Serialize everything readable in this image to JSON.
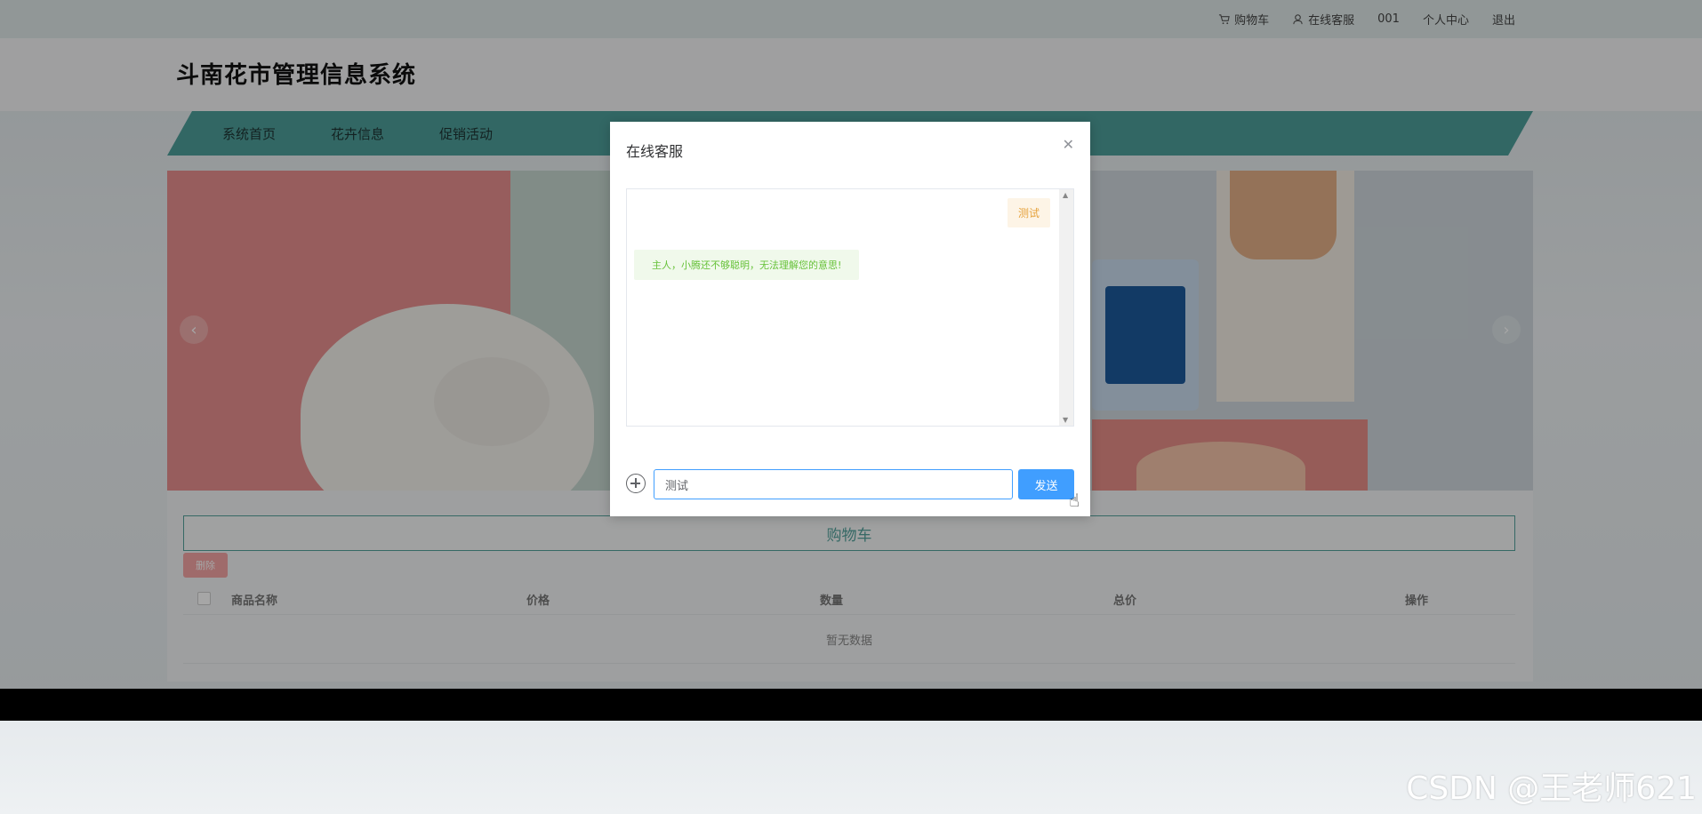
{
  "topbar": {
    "cart": "购物车",
    "service": "在线客服",
    "user": "001",
    "profile": "个人中心",
    "logout": "退出"
  },
  "site": {
    "title": "斗南花市管理信息系统"
  },
  "nav": {
    "items": [
      "系统首页",
      "花卉信息",
      "促销活动"
    ]
  },
  "carousel": {
    "prev_icon": "chevron-left-icon",
    "next_icon": "chevron-right-icon"
  },
  "cart": {
    "title": "购物车",
    "delete_label": "删除",
    "columns": [
      "商品名称",
      "价格",
      "数量",
      "总价",
      "操作"
    ],
    "empty_text": "暂无数据"
  },
  "dialog": {
    "title": "在线客服",
    "close_icon": "close-icon",
    "messages": [
      {
        "from": "user",
        "text": "测试"
      },
      {
        "from": "bot",
        "text": "主人，小腾还不够聪明，无法理解您的意思!"
      }
    ],
    "input_value": "测试",
    "send_label": "发送",
    "attach_icon": "plus-circle-icon"
  },
  "watermark": "CSDN @王老师621",
  "colors": {
    "accent": "#4e9f9a",
    "primary": "#409eff",
    "danger": "#f4a5a5"
  }
}
